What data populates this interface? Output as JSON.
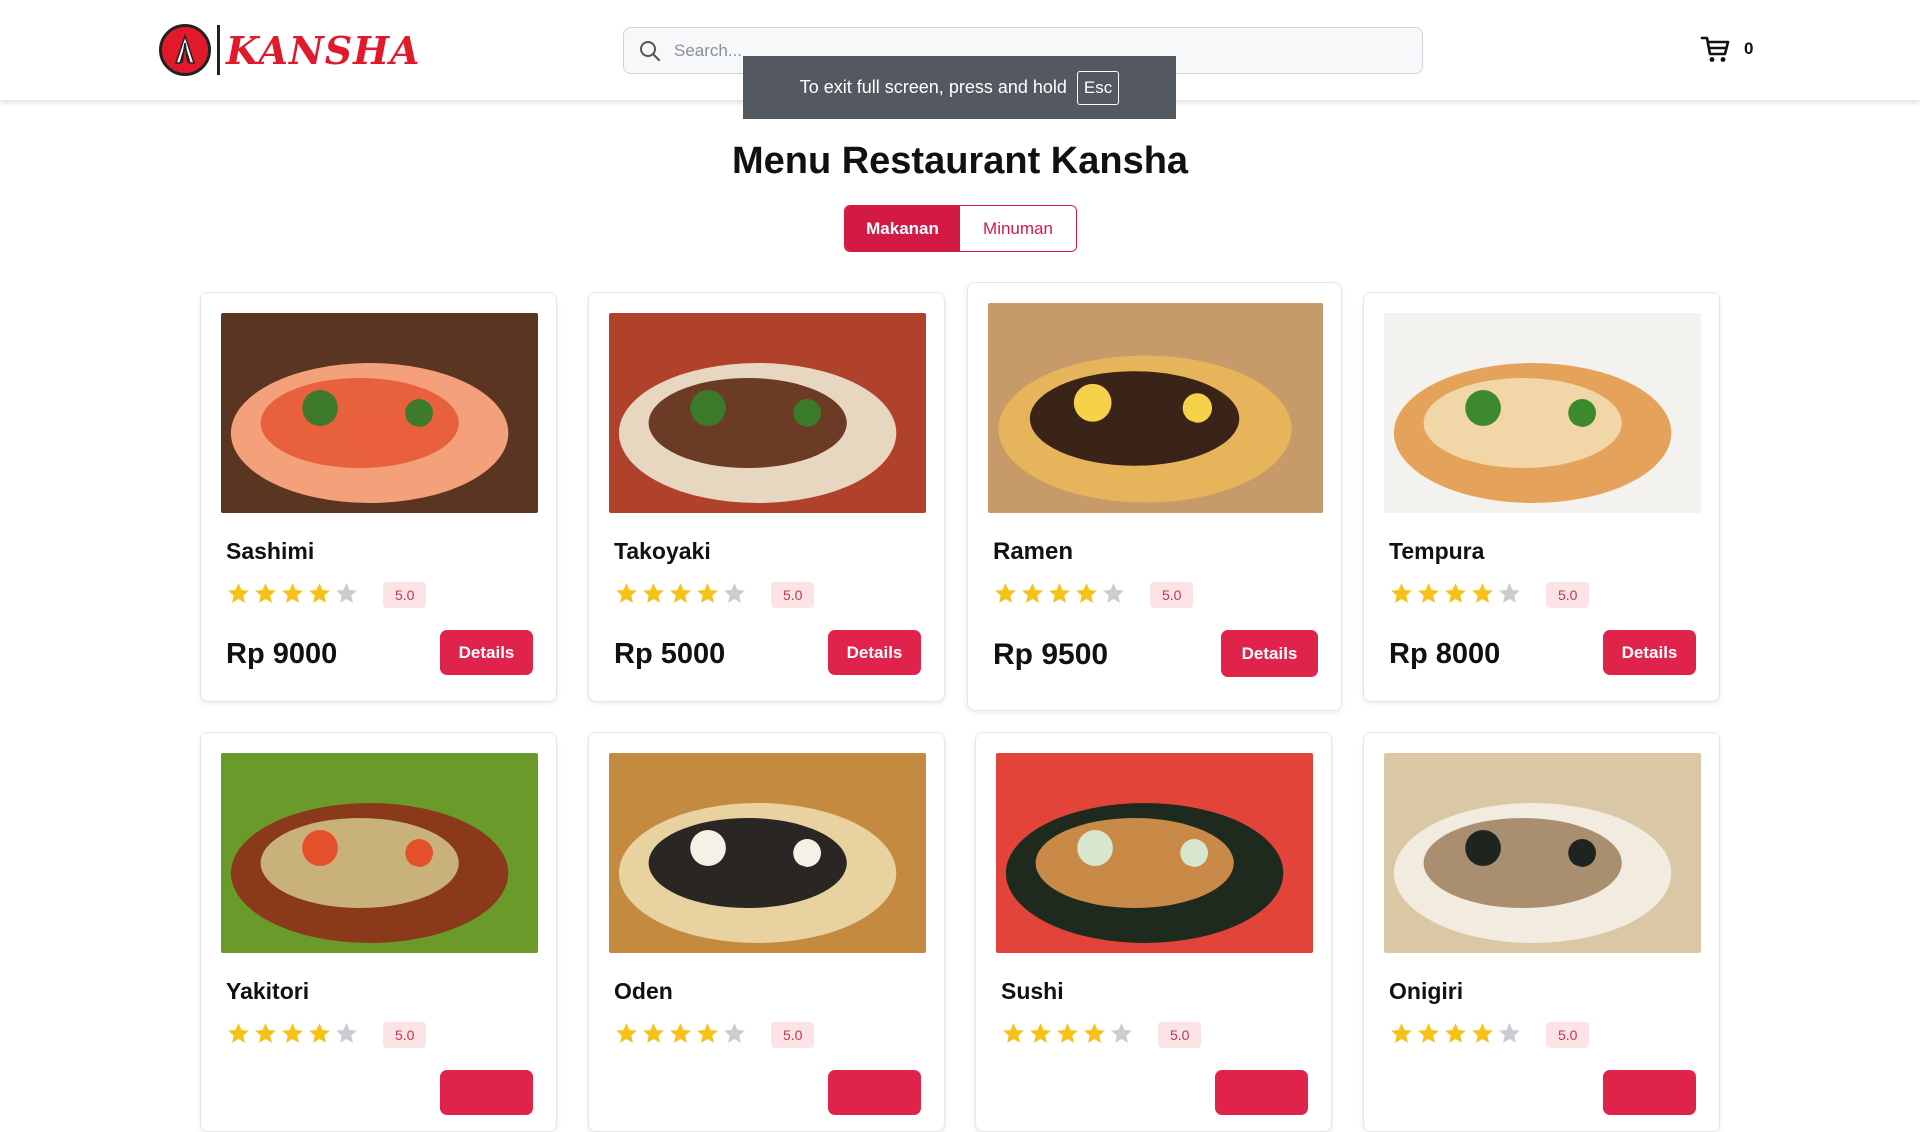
{
  "header": {
    "brand": "KANSHA",
    "search_placeholder": "Search...",
    "cart_count": "0"
  },
  "fullscreen_notice": {
    "text": "To exit full screen, press and hold",
    "key": "Esc"
  },
  "page": {
    "title": "Menu Restaurant Kansha",
    "tabs": [
      {
        "label": "Makanan",
        "active": true
      },
      {
        "label": "Minuman",
        "active": false
      }
    ]
  },
  "colors": {
    "accent": "#d31a45",
    "star_filled": "#f6c21a",
    "star_empty": "#c9ccd1"
  },
  "menu": [
    {
      "name": "Sashimi",
      "rating": "5.0",
      "stars_filled": 4,
      "price": "Rp 9000",
      "details_label": "Details"
    },
    {
      "name": "Takoyaki",
      "rating": "5.0",
      "stars_filled": 4,
      "price": "Rp 5000",
      "details_label": "Details"
    },
    {
      "name": "Ramen",
      "rating": "5.0",
      "stars_filled": 4,
      "price": "Rp 9500",
      "details_label": "Details"
    },
    {
      "name": "Tempura",
      "rating": "5.0",
      "stars_filled": 4,
      "price": "Rp 8000",
      "details_label": "Details"
    },
    {
      "name": "Yakitori",
      "rating": "5.0",
      "stars_filled": 4,
      "price": "",
      "details_label": ""
    },
    {
      "name": "Oden",
      "rating": "5.0",
      "stars_filled": 4,
      "price": "",
      "details_label": ""
    },
    {
      "name": "Sushi",
      "rating": "5.0",
      "stars_filled": 4,
      "price": "",
      "details_label": ""
    },
    {
      "name": "Onigiri",
      "rating": "5.0",
      "stars_filled": 4,
      "price": "",
      "details_label": ""
    }
  ]
}
